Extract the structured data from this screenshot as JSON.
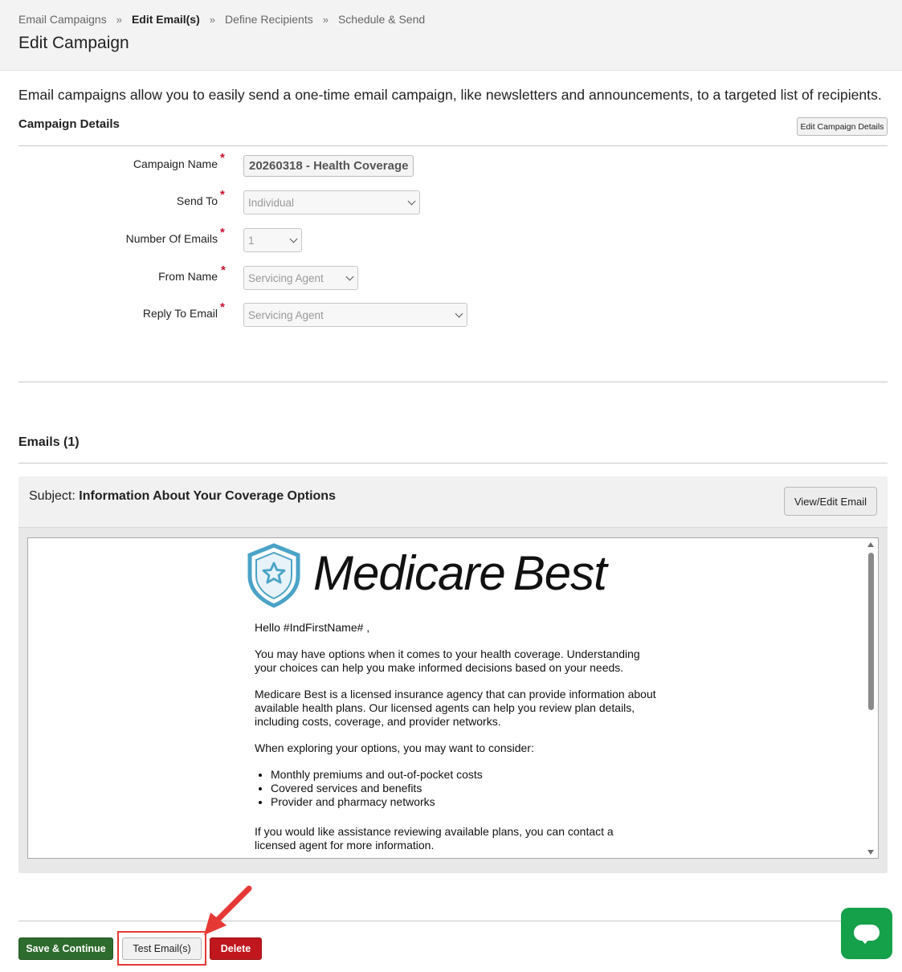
{
  "breadcrumb": {
    "items": [
      "Email Campaigns",
      "Edit Email(s)",
      "Define Recipients",
      "Schedule & Send"
    ],
    "separator": "»"
  },
  "page_title": "Edit Campaign",
  "intro": "Email campaigns allow you to easily send a one-time email campaign, like newsletters and announcements, to a targeted list of recipients.",
  "campaign_details": {
    "title": "Campaign Details",
    "edit_button": "Edit Campaign Details",
    "required_mark": "*",
    "fields": {
      "campaign_name": {
        "label": "Campaign Name",
        "value": "20260318 - Health Coverage"
      },
      "send_to": {
        "label": "Send To",
        "value": "Individual"
      },
      "number_of_emails": {
        "label": "Number Of Emails",
        "value": "1"
      },
      "from_name": {
        "label": "From Name",
        "value": "Servicing Agent"
      },
      "reply_to_email": {
        "label": "Reply To Email",
        "value": "Servicing Agent"
      }
    }
  },
  "emails": {
    "title": "Emails (1)",
    "subject_label": "Subject:",
    "subject": "Information About Your Coverage Options",
    "view_edit_button": "View/Edit Email",
    "preview": {
      "logo_text_1": "Medicare",
      "logo_text_2": "Best",
      "greeting": "Hello #IndFirstName# ,",
      "paragraph_1": "You may have options when it comes to your health coverage. Understanding your choices can help you make informed decisions based on your needs.",
      "paragraph_2": "Medicare Best is a licensed insurance agency that can provide information about available health plans. Our licensed agents can help you review plan details, including costs, coverage, and provider networks.",
      "paragraph_3": "When exploring your options, you may want to consider:",
      "list": [
        "Monthly premiums and out-of-pocket costs",
        "Covered services and benefits",
        "Provider and pharmacy networks"
      ],
      "paragraph_4": "If you would like assistance reviewing available plans, you can contact a licensed agent for more information."
    }
  },
  "actions": {
    "save_continue": "Save & Continue",
    "test_emails": "Test Email(s)",
    "delete": "Delete"
  },
  "colors": {
    "save": "#2e6b2e",
    "delete": "#c0161d",
    "chat": "#15a04a",
    "highlight": "#e53935",
    "logo_shield": "#4aa3c7"
  },
  "icons": {
    "chat": "chat-bubble-icon",
    "logo": "shield-star-icon",
    "annotation": "arrow-annotation"
  }
}
